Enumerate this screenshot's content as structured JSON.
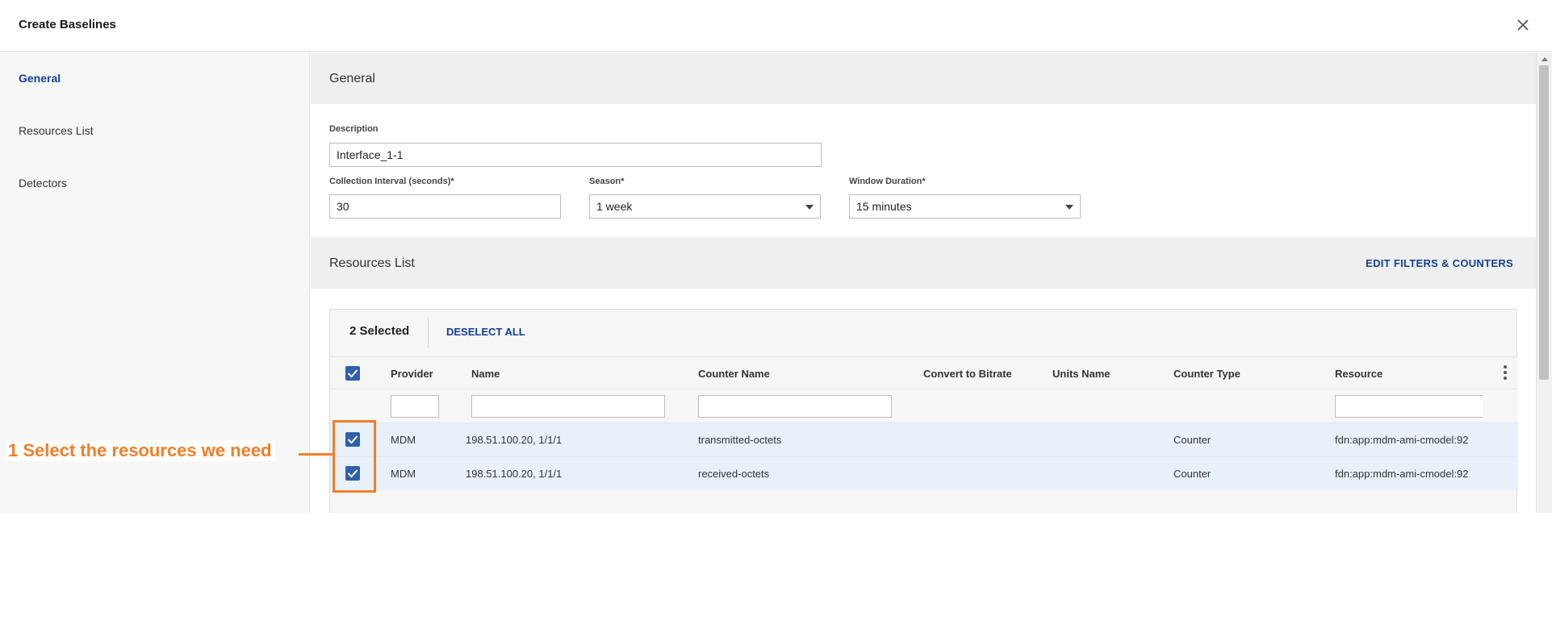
{
  "dialog": {
    "title": "Create Baselines"
  },
  "sidebar": {
    "items": [
      {
        "label": "General",
        "active": true
      },
      {
        "label": "Resources List",
        "active": false
      },
      {
        "label": "Detectors",
        "active": false
      }
    ]
  },
  "general": {
    "section_title": "General",
    "description_label": "Description",
    "description_value": "Interface_1-1",
    "interval_label": "Collection Interval (seconds)*",
    "interval_value": "30",
    "season_label": "Season*",
    "season_value": "1 week",
    "window_label": "Window Duration*",
    "window_value": "15 minutes"
  },
  "resources": {
    "section_title": "Resources List",
    "edit_link": "EDIT FILTERS & COUNTERS",
    "selected_count": "2 Selected",
    "deselect_all": "DESELECT ALL",
    "columns": [
      "Provider",
      "Name",
      "Counter Name",
      "Convert to Bitrate",
      "Units Name",
      "Counter Type",
      "Resource"
    ],
    "rows": [
      {
        "provider": "MDM",
        "name": "198.51.100.20, 1/1/1",
        "counter_name": "transmitted-octets",
        "convert": "",
        "units": "",
        "counter_type": "Counter",
        "resource": "fdn:app:mdm-ami-cmodel:92",
        "checked": true
      },
      {
        "provider": "MDM",
        "name": "198.51.100.20, 1/1/1",
        "counter_name": "received-octets",
        "convert": "",
        "units": "",
        "counter_type": "Counter",
        "resource": "fdn:app:mdm-ami-cmodel:92",
        "checked": true
      }
    ]
  },
  "annotation": {
    "text": "1 Select the resources we need"
  },
  "colors": {
    "accent": "#124191",
    "checkbox": "#2f5fa8",
    "annotation": "#f07f2a",
    "selected_row": "#e8f1fa"
  },
  "icons": {
    "close": "close-icon",
    "kebab": "kebab-menu-icon",
    "checkbox": "checkmark-icon",
    "dropdown": "caret-down-icon"
  }
}
